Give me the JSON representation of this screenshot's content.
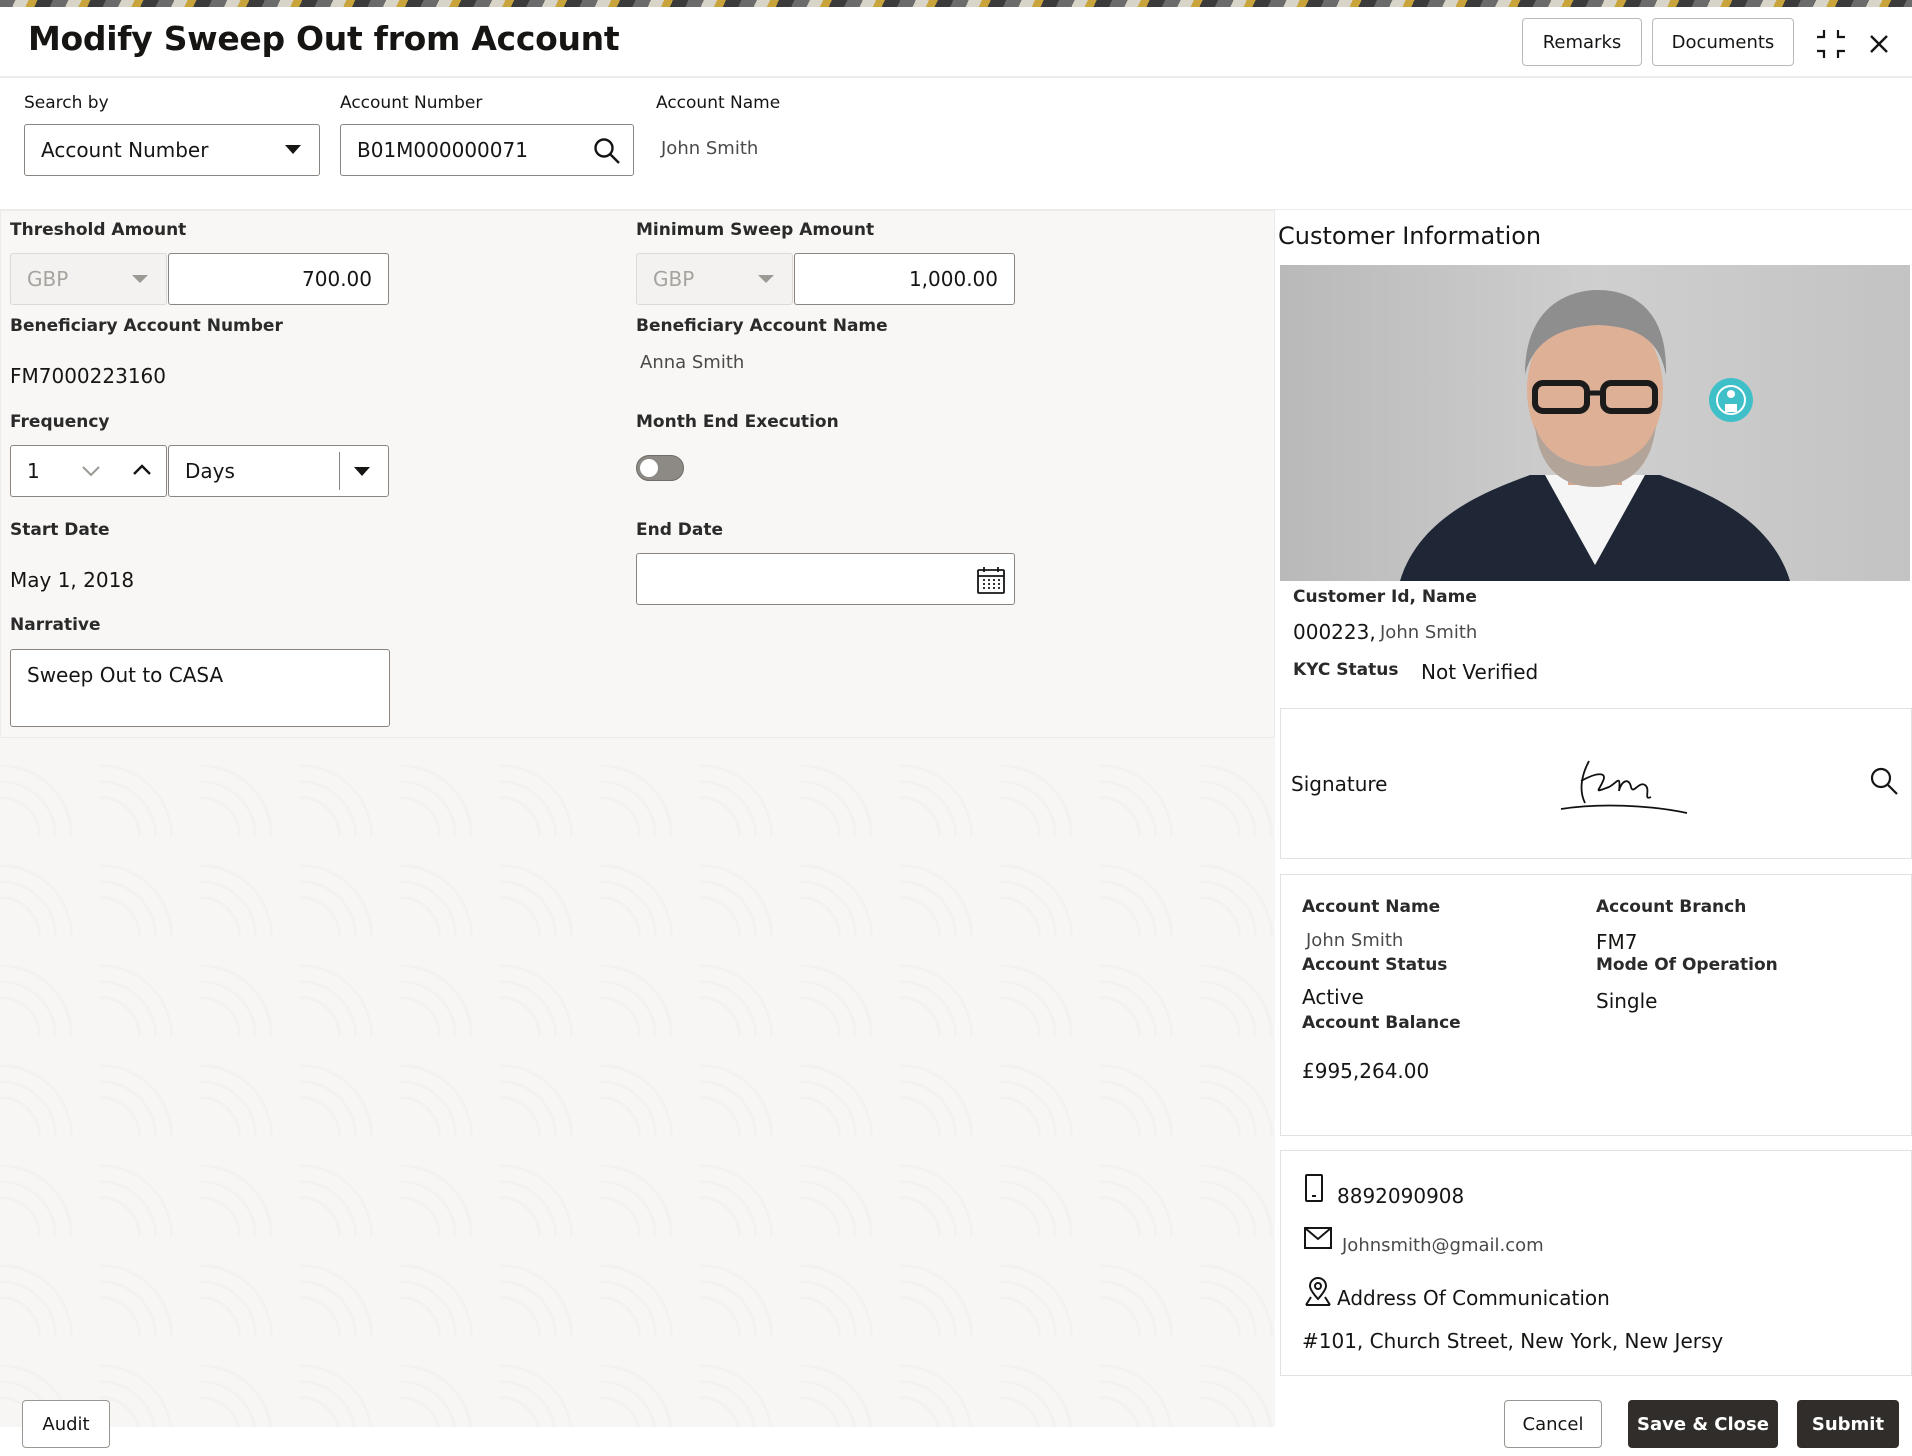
{
  "header": {
    "title": "Modify Sweep Out from Account",
    "remarks_label": "Remarks",
    "documents_label": "Documents"
  },
  "search": {
    "search_by_label": "Search by",
    "search_by_value": "Account Number",
    "account_number_label": "Account Number",
    "account_number_value": "B01M000000071",
    "account_name_label": "Account Name",
    "account_name_value": "John Smith"
  },
  "form": {
    "threshold_label": "Threshold Amount",
    "threshold_currency": "GBP",
    "threshold_amount": "700.00",
    "min_sweep_label": "Minimum Sweep Amount",
    "min_sweep_currency": "GBP",
    "min_sweep_amount": "1,000.00",
    "beneficiary_number_label": "Beneficiary Account Number",
    "beneficiary_number_value": "FM7000223160",
    "beneficiary_name_label": "Beneficiary Account Name",
    "beneficiary_name_value": "Anna Smith",
    "frequency_label": "Frequency",
    "frequency_value": "1",
    "frequency_unit": "Days",
    "month_end_label": "Month End Execution",
    "month_end_on": false,
    "start_date_label": "Start Date",
    "start_date_value": "May 1, 2018",
    "end_date_label": "End Date",
    "end_date_value": "",
    "narrative_label": "Narrative",
    "narrative_value": "Sweep Out to CASA"
  },
  "customer": {
    "section_title": "Customer Information",
    "id_name_label": "Customer Id, Name",
    "customer_id": "000223,",
    "customer_name": "John Smith",
    "kyc_label": "KYC Status",
    "kyc_value": "Not Verified",
    "signature_label": "Signature"
  },
  "account": {
    "name_label": "Account Name",
    "name_value": "John Smith",
    "branch_label": "Account Branch",
    "branch_value": "FM7",
    "status_label": "Account Status",
    "status_value": "Active",
    "mode_label": "Mode Of Operation",
    "mode_value": "Single",
    "balance_label": "Account Balance",
    "balance_value": "£995,264.00"
  },
  "contact": {
    "phone": "8892090908",
    "email": "Johnsmith@gmail.com",
    "address_label": "Address Of Communication",
    "address_value": "#101, Church Street, New York, New Jersy"
  },
  "footer": {
    "audit_label": "Audit",
    "cancel_label": "Cancel",
    "save_close_label": "Save & Close",
    "submit_label": "Submit"
  },
  "colors": {
    "dark_button": "#312d2a",
    "accent_teal": "#3fbfc7"
  }
}
